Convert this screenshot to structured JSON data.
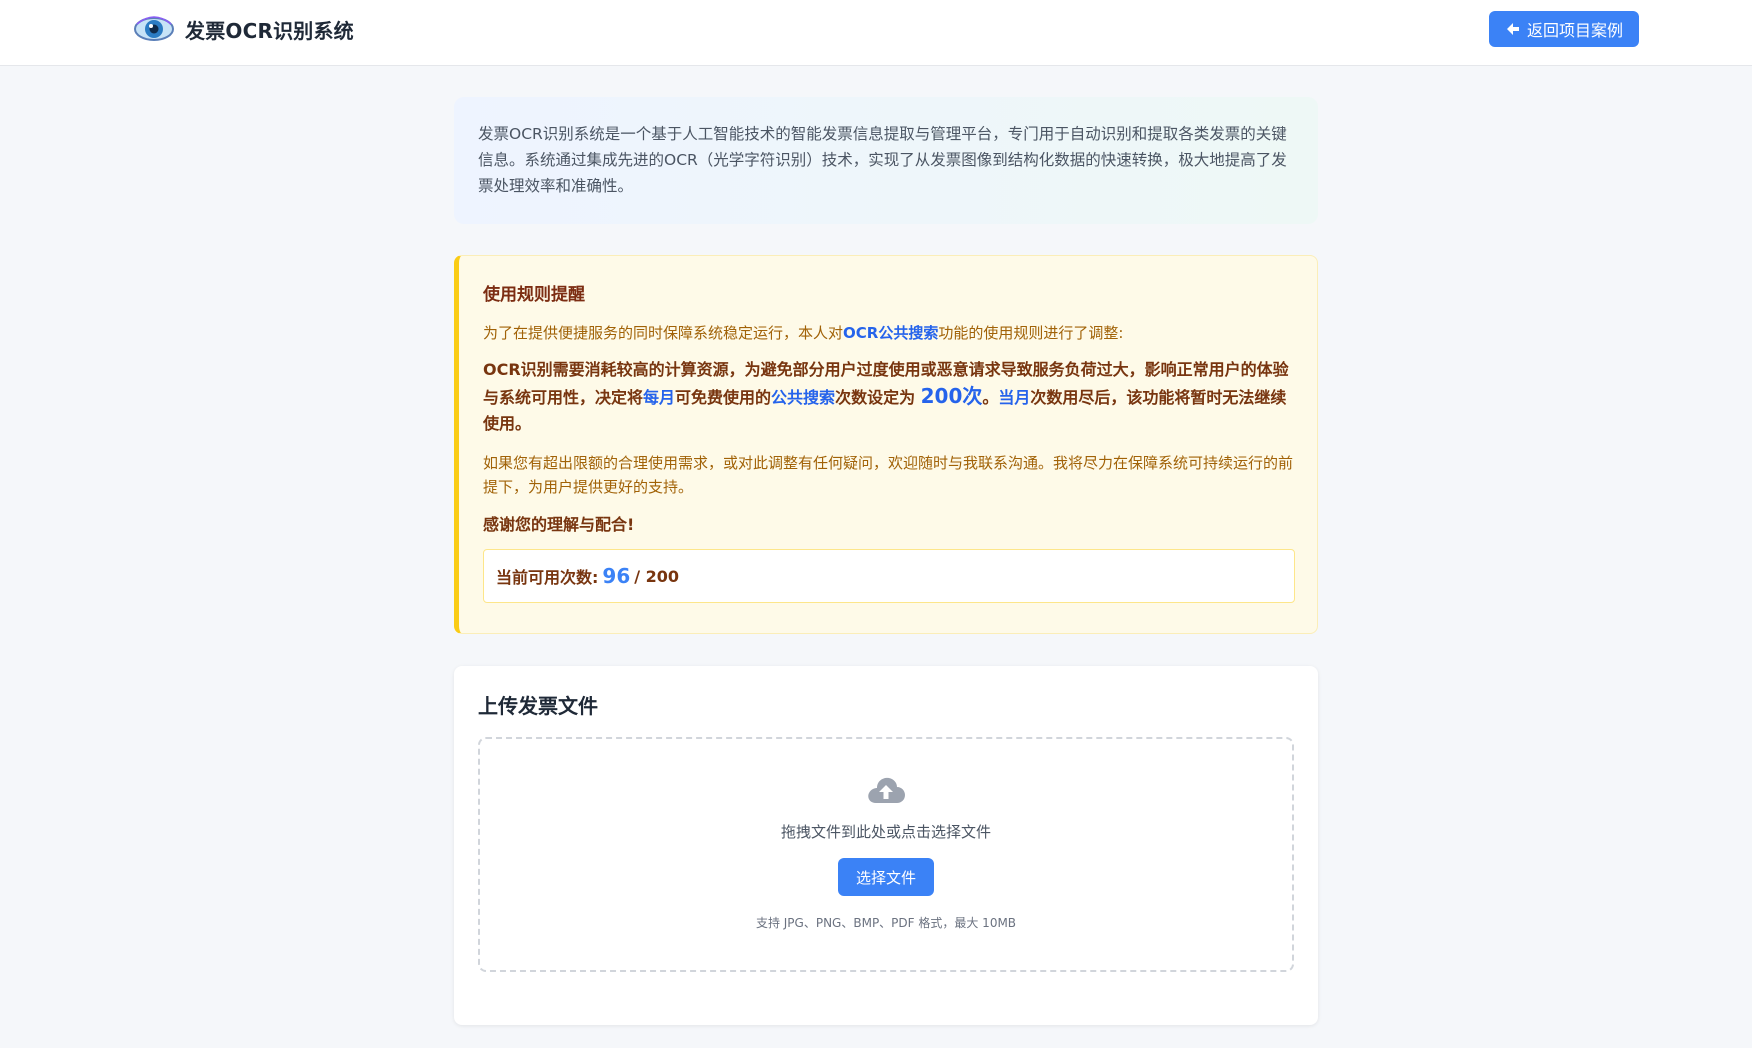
{
  "header": {
    "app_title": "发票OCR识别系统",
    "logo_icon": "eye-icon",
    "back_button_label": "返回项目案例",
    "back_icon": "arrow-left-icon"
  },
  "intro": {
    "text": "发票OCR识别系统是一个基于人工智能技术的智能发票信息提取与管理平台，专门用于自动识别和提取各类发票的关键信息。系统通过集成先进的OCR（光学字符识别）技术，实现了从发票图像到结构化数据的快速转换，极大地提高了发票处理效率和准确性。"
  },
  "notice": {
    "title": "使用规则提醒",
    "p1_prefix": "为了在提供便捷服务的同时保障系统稳定运行，本人对",
    "p1_highlight": "OCR公共搜索",
    "p1_suffix": "功能的使用规则进行了调整:",
    "strong_part1": "OCR识别需要消耗较高的计算资源，为避免部分用户过度使用或恶意请求导致服务负荷过大，影响正常用户的体验与系统可用性，决定将",
    "strong_hl1": "每月",
    "strong_part2": "可免费使用的",
    "strong_hl2": "公共搜索",
    "strong_part3": "次数设定为 ",
    "strong_hl3": "200次",
    "strong_part4": "。",
    "strong_hl4": "当月",
    "strong_part5": "次数用尽后，该功能将暂时无法继续使用。",
    "p2": "如果您有超出限额的合理使用需求，或对此调整有任何疑问，欢迎随时与我联系沟通。我将尽力在保障系统可持续运行的前提下，为用户提供更好的支持。",
    "thanks": "感谢您的理解与配合!",
    "usage_label": "当前可用次数:",
    "usage_remaining": "96",
    "usage_total": "/ 200"
  },
  "upload": {
    "title": "上传发票文件",
    "cloud_icon": "cloud-upload-icon",
    "drag_text": "拖拽文件到此处或点击选择文件",
    "select_button": "选择文件",
    "hint": "支持 JPG、PNG、BMP、PDF 格式，最大 10MB"
  },
  "colors": {
    "accent": "#3b82f6",
    "notice_border": "#facc15",
    "notice_bg": "#fefae8"
  }
}
